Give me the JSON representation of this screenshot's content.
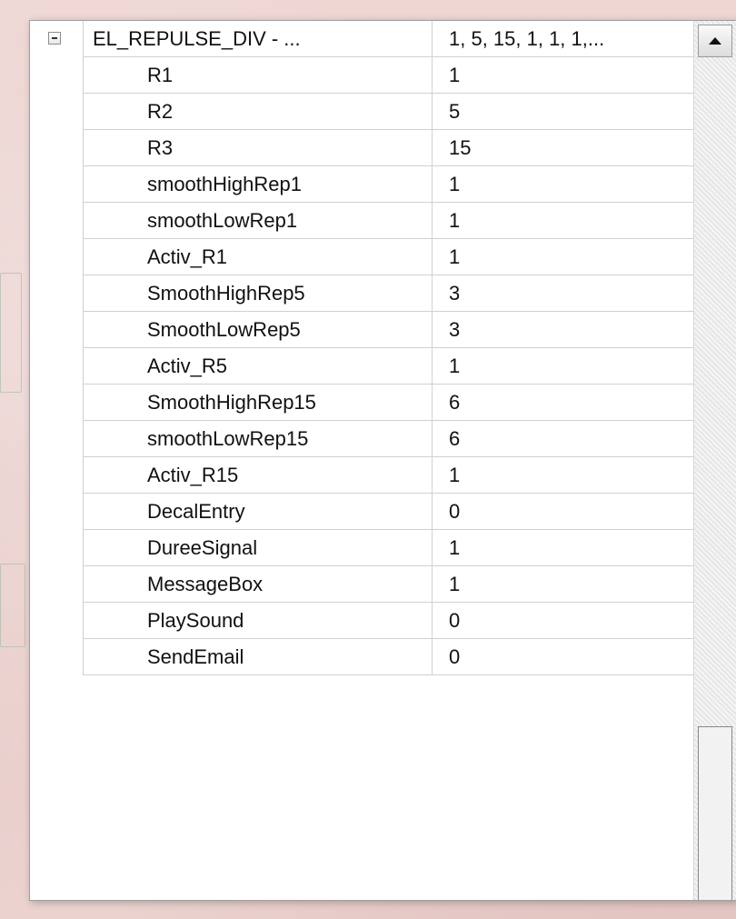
{
  "group": {
    "name": "EL_REPULSE_DIV - ...",
    "value": "1, 5, 15, 1, 1, 1,..."
  },
  "properties": [
    {
      "name": "R1",
      "value": "1"
    },
    {
      "name": "R2",
      "value": "5"
    },
    {
      "name": "R3",
      "value": "15"
    },
    {
      "name": "smoothHighRep1",
      "value": "1"
    },
    {
      "name": "smoothLowRep1",
      "value": "1"
    },
    {
      "name": "Activ_R1",
      "value": "1"
    },
    {
      "name": "SmoothHighRep5",
      "value": "3"
    },
    {
      "name": "SmoothLowRep5",
      "value": "3"
    },
    {
      "name": "Activ_R5",
      "value": "1"
    },
    {
      "name": "SmoothHighRep15",
      "value": "6"
    },
    {
      "name": "smoothLowRep15",
      "value": "6"
    },
    {
      "name": "Activ_R15",
      "value": "1"
    },
    {
      "name": "DecalEntry",
      "value": "0"
    },
    {
      "name": "DureeSignal",
      "value": "1"
    },
    {
      "name": "MessageBox",
      "value": "1"
    },
    {
      "name": "PlaySound",
      "value": "0"
    },
    {
      "name": "SendEmail",
      "value": "0"
    }
  ],
  "icons": {
    "collapse": "minus-box-icon",
    "scroll_up": "triangle-up-icon"
  },
  "colors": {
    "background": "#e9cfcc",
    "panel": "#ffffff",
    "gridline": "#d0d0d0"
  }
}
